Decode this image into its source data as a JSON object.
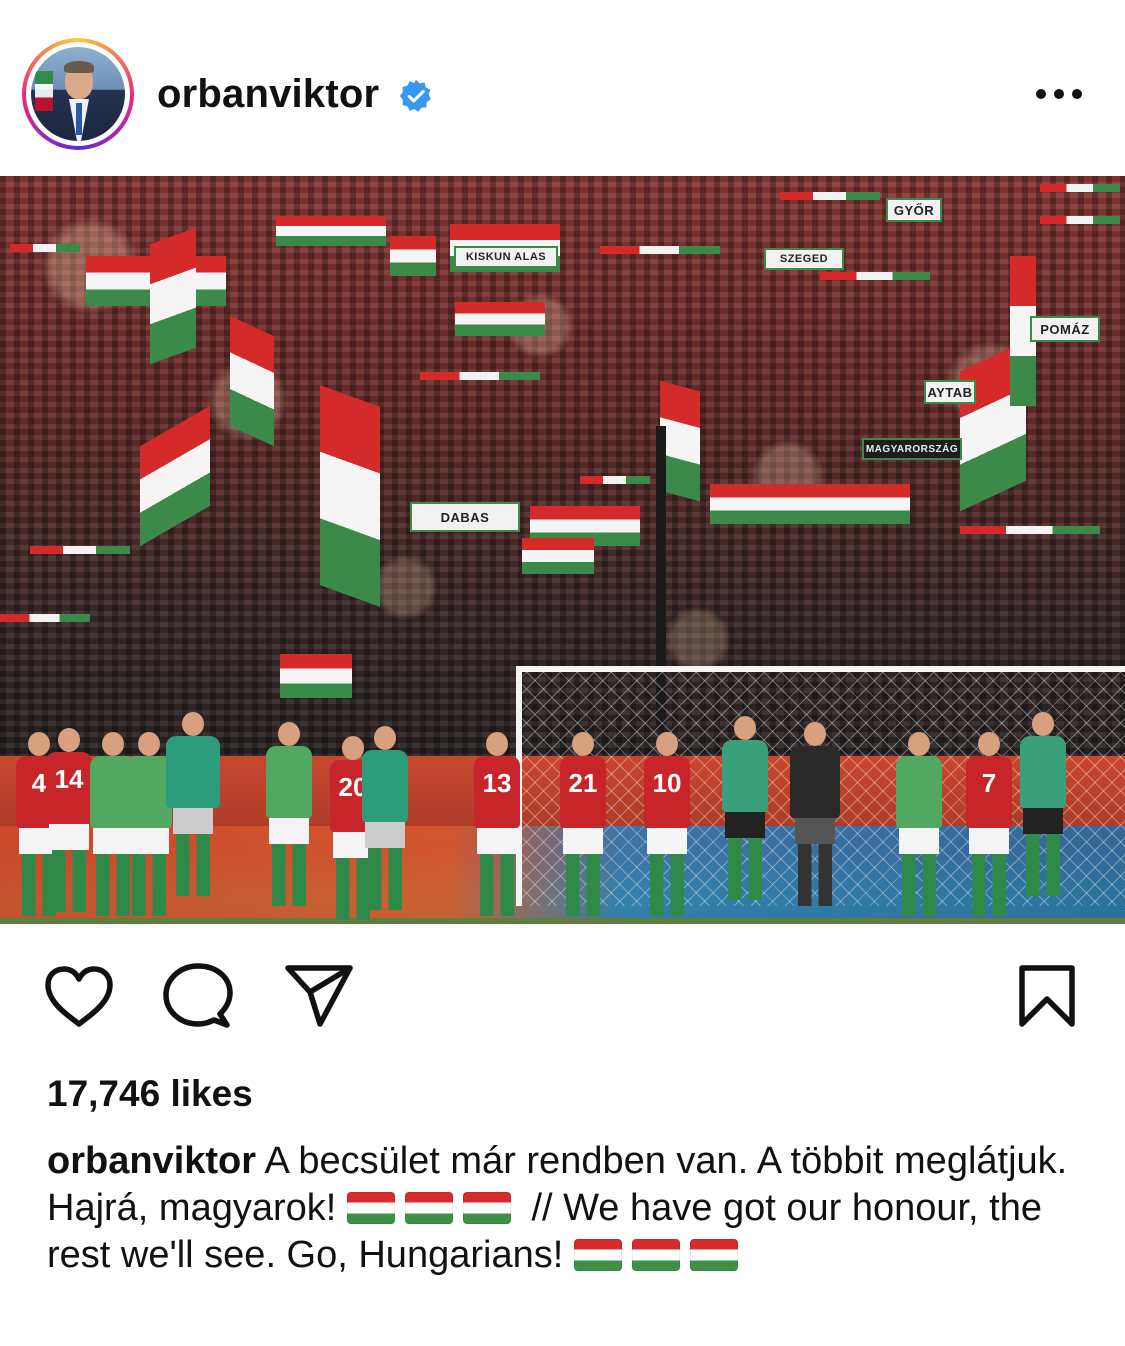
{
  "post": {
    "username": "orbanviktor",
    "verified": true,
    "more_icon": "more-horizontal-icon",
    "photo": {
      "banners": {
        "dabas": "DABAS",
        "gyor": "GYŐR",
        "pomaz": "POMÁZ",
        "aytab": "AYTAB",
        "kiskunhalas": "KISKUN  ALAS",
        "szeged": "SZEGED",
        "magyarorszag": "MAGYARORSZÁG"
      },
      "player_numbers": [
        "4",
        "14",
        "20",
        "13",
        "21",
        "10",
        "7"
      ]
    },
    "actions": {
      "like_icon": "heart-icon",
      "comment_icon": "comment-icon",
      "share_icon": "send-icon",
      "save_icon": "bookmark-icon"
    },
    "likes_text": "17,746 likes",
    "caption": {
      "user": "orbanviktor",
      "text_hu": " A becsület már rendben van. A többit meglátjuk. Hajrá, magyarok! ",
      "text_en": " // We have got our honour, the rest we'll see. Go, Hungarians! "
    },
    "colors": {
      "verified_blue": "#3897f0",
      "flag_red": "#d62c2c",
      "flag_white": "#ffffff",
      "flag_green": "#3f8f47"
    }
  }
}
